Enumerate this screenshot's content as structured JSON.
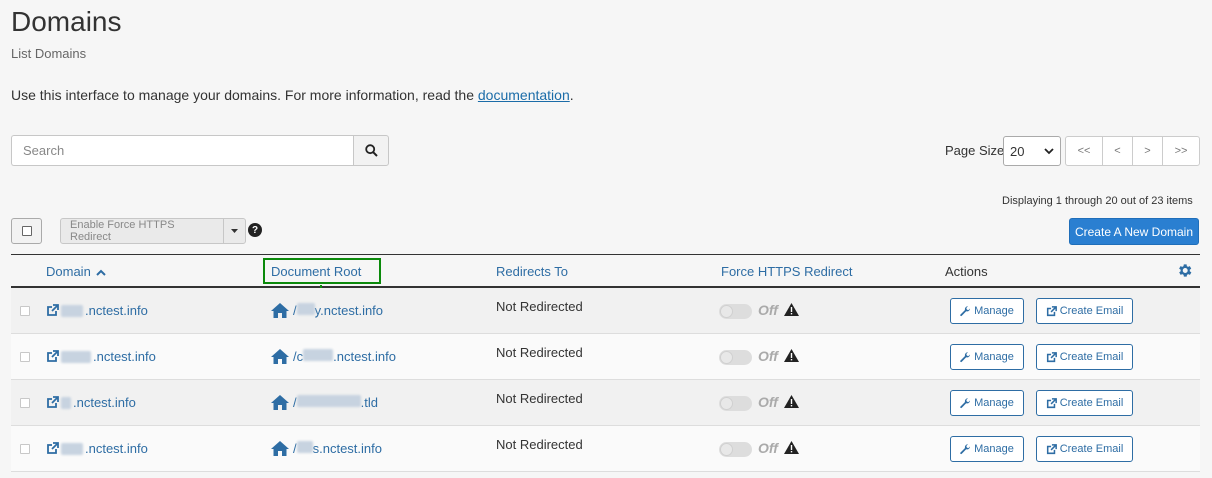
{
  "header": {
    "title": "Domains",
    "subtitle": "List Domains",
    "intro_text": "Use this interface to manage your domains. For more information, read the ",
    "intro_link": "documentation",
    "intro_end": "."
  },
  "search": {
    "placeholder": "Search",
    "value": ""
  },
  "pagination": {
    "page_size_label": "Page Size",
    "page_size_value": "20",
    "first": "<<",
    "prev": "<",
    "next": ">",
    "last": ">>",
    "display_text": "Displaying 1 through 20 out of 23 items"
  },
  "toolbar": {
    "bulk_action_label": "Enable Force HTTPS Redirect",
    "help_label": "?",
    "create_label": "Create A New Domain"
  },
  "table": {
    "columns": [
      "Domain",
      "Document Root",
      "Redirects To",
      "Force HTTPS Redirect",
      "Actions"
    ],
    "rows": [
      {
        "domain": ".nctest.info",
        "root_prefix": "/",
        "root": "y.nctest.info",
        "redirect": "Not Redirected",
        "https": "Off",
        "manage": "Manage",
        "email": "Create Email"
      },
      {
        "domain": ".nctest.info",
        "root_prefix": "/c",
        "root": ".nctest.info",
        "redirect": "Not Redirected",
        "https": "Off",
        "manage": "Manage",
        "email": "Create Email"
      },
      {
        "domain": ".nctest.info",
        "root_prefix": "/",
        "root": ".tld",
        "redirect": "Not Redirected",
        "https": "Off",
        "manage": "Manage",
        "email": "Create Email"
      },
      {
        "domain": ".nctest.info",
        "root_prefix": "/",
        "root": "s.nctest.info",
        "redirect": "Not Redirected",
        "https": "Off",
        "manage": "Manage",
        "email": "Create Email"
      }
    ]
  },
  "colors": {
    "link": "#2e6da4",
    "primary_button": "#2a7fd1",
    "annotation": "#0b8a0b"
  },
  "icons": [
    "search-icon",
    "caret-down-icon",
    "help-icon",
    "sort-up-icon",
    "gear-icon",
    "external-link-icon",
    "home-icon",
    "warning-icon",
    "wrench-icon",
    "arrow-down-icon"
  ]
}
